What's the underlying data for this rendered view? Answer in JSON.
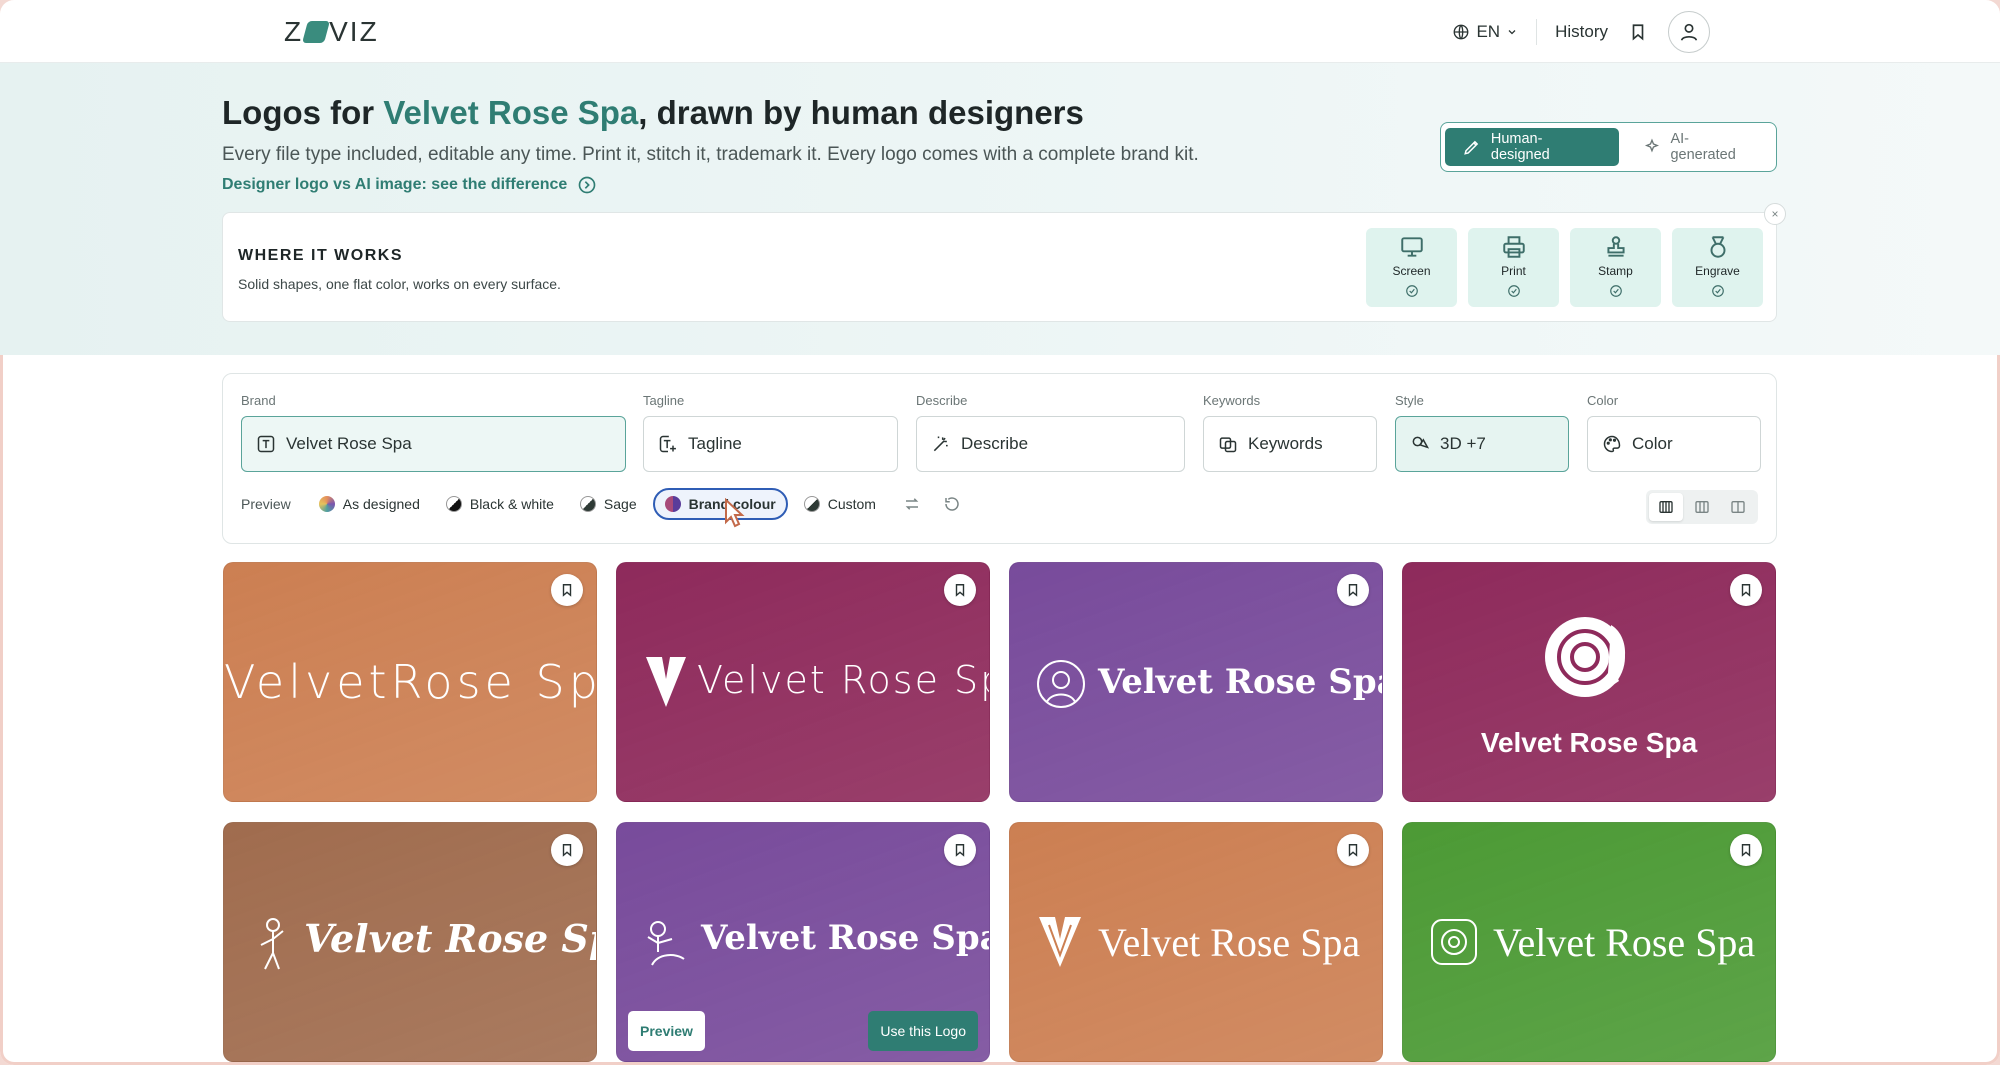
{
  "app": {
    "logo_text_left": "Z",
    "logo_text_right": "VIZ"
  },
  "nav": {
    "language": "EN",
    "history": "History"
  },
  "hero": {
    "title_prefix": "Logos for ",
    "title_brand": "Velvet Rose Spa",
    "title_suffix": ", drawn by human designers",
    "subtitle": "Every file type included, editable any time. Print it, stitch it, trademark it. Every logo comes with a complete brand kit.",
    "link": "Designer logo vs AI image: see the difference",
    "toggle": {
      "human": "Human-designed",
      "ai": "AI-generated"
    }
  },
  "works": {
    "title": "WHERE IT WORKS",
    "description": "Solid shapes, one flat color, works on every surface.",
    "close": "×",
    "surfaces": [
      {
        "label": "Screen",
        "icon": "monitor-icon"
      },
      {
        "label": "Print",
        "icon": "printer-icon"
      },
      {
        "label": "Stamp",
        "icon": "stamp-icon"
      },
      {
        "label": "Engrave",
        "icon": "medal-icon"
      }
    ]
  },
  "filters": {
    "brand": {
      "label": "Brand",
      "value": "Velvet Rose Spa"
    },
    "tagline": {
      "label": "Tagline",
      "placeholder": "Tagline"
    },
    "describe": {
      "label": "Describe",
      "placeholder": "Describe"
    },
    "keywords": {
      "label": "Keywords",
      "placeholder": "Keywords"
    },
    "style": {
      "label": "Style",
      "value": "3D +7"
    },
    "color": {
      "label": "Color",
      "placeholder": "Color"
    },
    "preview_label": "Preview",
    "preview_options": [
      "As designed",
      "Black & white",
      "Sage",
      "Brand colour",
      "Custom"
    ],
    "preview_selected": "Brand colour"
  },
  "cards": [
    {
      "text": "VelvetRose Spa",
      "bg": "#cc7f52",
      "style": "wide"
    },
    {
      "text": "Velvet Rose Spa",
      "bg": "#8e2a5b",
      "style": "thin"
    },
    {
      "text": "Velvet Rose Spa",
      "bg": "#784b9b",
      "style": "bold"
    },
    {
      "text": "Velvet Rose Spa",
      "bg": "#8e2a5b",
      "style": "stacked"
    },
    {
      "text": "Velvet Rose Spa",
      "bg": "#a06c4e",
      "style": "bold"
    },
    {
      "text": "Velvet Rose Spa",
      "bg": "#784b9b",
      "style": "bold"
    },
    {
      "text": "Velvet Rose Spa",
      "bg": "#cc7f52",
      "style": "medium"
    },
    {
      "text": "Velvet Rose Spa",
      "bg": "#4c9a35",
      "style": "serif"
    }
  ],
  "card_actions": {
    "preview": "Preview",
    "use": "Use this Logo"
  }
}
